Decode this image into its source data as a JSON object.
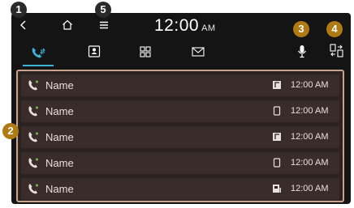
{
  "header": {
    "time": "12:00",
    "ampm": "AM"
  },
  "tabs": [
    {
      "icon": "call-log-icon",
      "active": true
    },
    {
      "icon": "contacts-icon",
      "active": false
    },
    {
      "icon": "keypad-icon",
      "active": false
    },
    {
      "icon": "message-icon",
      "active": false
    }
  ],
  "calls": [
    {
      "name": "Name",
      "time": "12:00 AM",
      "device": "tablet-icon"
    },
    {
      "name": "Name",
      "time": "12:00 AM",
      "device": "mobile-icon"
    },
    {
      "name": "Name",
      "time": "12:00 AM",
      "device": "tablet-icon"
    },
    {
      "name": "Name",
      "time": "12:00 AM",
      "device": "mobile-icon"
    },
    {
      "name": "Name",
      "time": "12:00 AM",
      "device": "car-icon"
    }
  ],
  "callouts": [
    "1",
    "2",
    "3",
    "4",
    "5"
  ],
  "colors": {
    "accent": "#3bb3d6",
    "list_border": "#c7a390",
    "row_bg": "#3a2c28",
    "callout_gold": "#b07a12"
  }
}
